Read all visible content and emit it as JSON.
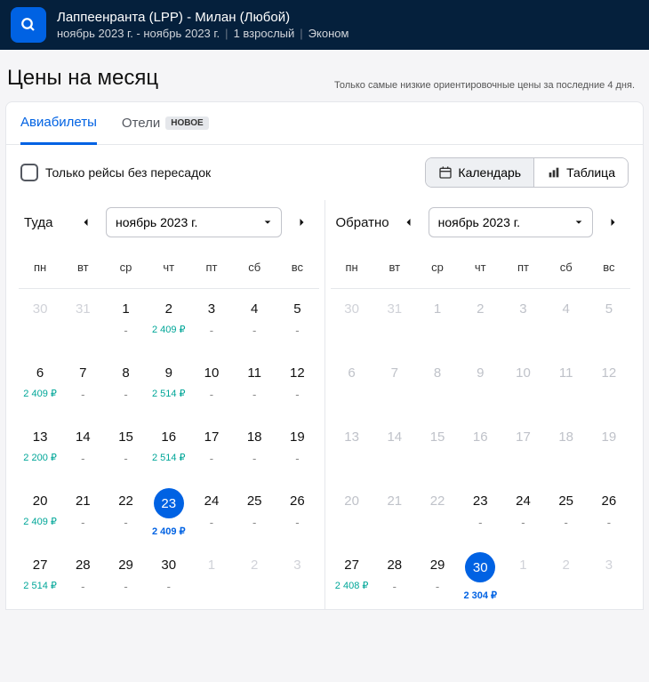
{
  "header": {
    "route": "Лаппеенранта (LPP) - Милан (Любой)",
    "dates": "ноябрь 2023 г. - ноябрь 2023 г.",
    "pax": "1 взрослый",
    "cabin": "Эконом"
  },
  "page": {
    "title": "Цены на месяц",
    "note": "Только самые низкие ориентировочные цены за последние 4 дня."
  },
  "tabs": {
    "flights": "Авиабилеты",
    "hotels": "Отели",
    "new_badge": "НОВОЕ"
  },
  "controls": {
    "direct_only": "Только рейсы без пересадок",
    "calendar": "Календарь",
    "table": "Таблица"
  },
  "dow": [
    "пн",
    "вт",
    "ср",
    "чт",
    "пт",
    "сб",
    "вс"
  ],
  "outbound": {
    "label": "Туда",
    "month": "ноябрь 2023 г.",
    "cells": [
      {
        "d": "30",
        "faded": true
      },
      {
        "d": "31",
        "faded": true
      },
      {
        "d": "1",
        "dash": true
      },
      {
        "d": "2",
        "price": "2 409 ₽"
      },
      {
        "d": "3",
        "dash": true
      },
      {
        "d": "4",
        "dash": true
      },
      {
        "d": "5",
        "dash": true
      },
      {
        "d": "6",
        "price": "2 409 ₽"
      },
      {
        "d": "7",
        "dash": true
      },
      {
        "d": "8",
        "dash": true
      },
      {
        "d": "9",
        "price": "2 514 ₽"
      },
      {
        "d": "10",
        "dash": true
      },
      {
        "d": "11",
        "dash": true
      },
      {
        "d": "12",
        "dash": true
      },
      {
        "d": "13",
        "price": "2 200 ₽"
      },
      {
        "d": "14",
        "dash": true
      },
      {
        "d": "15",
        "dash": true
      },
      {
        "d": "16",
        "price": "2 514 ₽"
      },
      {
        "d": "17",
        "dash": true
      },
      {
        "d": "18",
        "dash": true
      },
      {
        "d": "19",
        "dash": true
      },
      {
        "d": "20",
        "price": "2 409 ₽"
      },
      {
        "d": "21",
        "dash": true
      },
      {
        "d": "22",
        "dash": true
      },
      {
        "d": "23",
        "price": "2 409 ₽",
        "selected": true
      },
      {
        "d": "24",
        "dash": true
      },
      {
        "d": "25",
        "dash": true
      },
      {
        "d": "26",
        "dash": true
      },
      {
        "d": "27",
        "price": "2 514 ₽"
      },
      {
        "d": "28",
        "dash": true
      },
      {
        "d": "29",
        "dash": true
      },
      {
        "d": "30",
        "dash": true
      },
      {
        "d": "1",
        "faded": true
      },
      {
        "d": "2",
        "faded": true
      },
      {
        "d": "3",
        "faded": true
      }
    ]
  },
  "return": {
    "label": "Обратно",
    "month": "ноябрь 2023 г.",
    "cells": [
      {
        "d": "30",
        "faded": true
      },
      {
        "d": "31",
        "faded": true
      },
      {
        "d": "1",
        "muted": true
      },
      {
        "d": "2",
        "muted": true
      },
      {
        "d": "3",
        "muted": true
      },
      {
        "d": "4",
        "muted": true
      },
      {
        "d": "5",
        "muted": true
      },
      {
        "d": "6",
        "muted": true
      },
      {
        "d": "7",
        "muted": true
      },
      {
        "d": "8",
        "muted": true
      },
      {
        "d": "9",
        "muted": true
      },
      {
        "d": "10",
        "muted": true
      },
      {
        "d": "11",
        "muted": true
      },
      {
        "d": "12",
        "muted": true
      },
      {
        "d": "13",
        "muted": true
      },
      {
        "d": "14",
        "muted": true
      },
      {
        "d": "15",
        "muted": true
      },
      {
        "d": "16",
        "muted": true
      },
      {
        "d": "17",
        "muted": true
      },
      {
        "d": "18",
        "muted": true
      },
      {
        "d": "19",
        "muted": true
      },
      {
        "d": "20",
        "muted": true
      },
      {
        "d": "21",
        "muted": true
      },
      {
        "d": "22",
        "muted": true
      },
      {
        "d": "23",
        "dash": true
      },
      {
        "d": "24",
        "dash": true
      },
      {
        "d": "25",
        "dash": true
      },
      {
        "d": "26",
        "dash": true
      },
      {
        "d": "27",
        "price": "2 408 ₽"
      },
      {
        "d": "28",
        "dash": true
      },
      {
        "d": "29",
        "dash": true
      },
      {
        "d": "30",
        "price": "2 304 ₽",
        "selected": true
      },
      {
        "d": "1",
        "faded": true
      },
      {
        "d": "2",
        "faded": true
      },
      {
        "d": "3",
        "faded": true
      }
    ]
  }
}
